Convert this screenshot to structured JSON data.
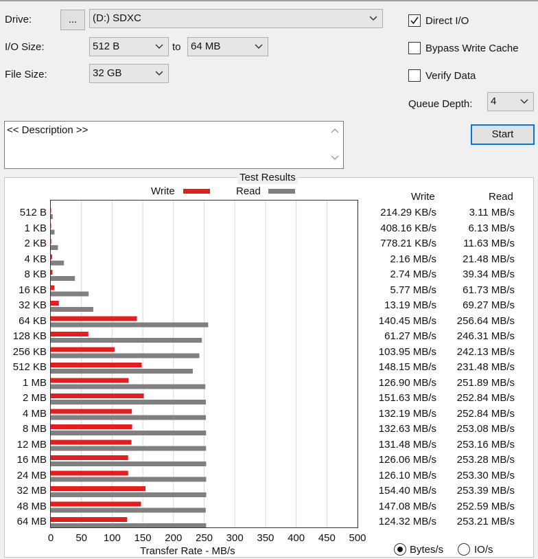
{
  "controls": {
    "drive_label": "Drive:",
    "browse_label": "...",
    "drive_value": "(D:) SDXC",
    "io_size_label": "I/O Size:",
    "io_from": "512 B",
    "io_to_label": "to",
    "io_to": "64 MB",
    "file_size_label": "File Size:",
    "file_size": "32 GB",
    "direct_io_label": "Direct I/O",
    "direct_io_checked": true,
    "bypass_cache_label": "Bypass Write Cache",
    "bypass_cache_checked": false,
    "verify_label": "Verify Data",
    "verify_checked": false,
    "queue_depth_label": "Queue Depth:",
    "queue_depth": "4",
    "start_label": "Start",
    "description": "<< Description >>"
  },
  "results": {
    "group_title": "Test Results",
    "legend_write": "Write",
    "legend_read": "Read",
    "col_write": "Write",
    "col_read": "Read",
    "x_axis_label": "Transfer Rate - MB/s",
    "unit_bytes_label": "Bytes/s",
    "unit_io_label": "IO/s",
    "unit_selected": "Bytes/s"
  },
  "colors": {
    "write": "#e02020",
    "read": "#808080",
    "focus": "#0078d7"
  },
  "chart_data": {
    "type": "bar",
    "orientation": "horizontal",
    "categories": [
      "512 B",
      "1 KB",
      "2 KB",
      "4 KB",
      "8 KB",
      "16 KB",
      "32 KB",
      "64 KB",
      "128 KB",
      "256 KB",
      "512 KB",
      "1 MB",
      "2 MB",
      "4 MB",
      "8 MB",
      "12 MB",
      "16 MB",
      "24 MB",
      "32 MB",
      "48 MB",
      "64 MB"
    ],
    "series": [
      {
        "name": "Write",
        "values": [
          0.21,
          0.4,
          0.76,
          2.16,
          2.74,
          5.77,
          13.19,
          140.45,
          61.27,
          103.95,
          148.15,
          126.9,
          151.63,
          132.19,
          132.63,
          131.48,
          126.06,
          126.1,
          154.4,
          147.08,
          124.32
        ]
      },
      {
        "name": "Read",
        "values": [
          3.11,
          6.13,
          11.63,
          21.48,
          39.34,
          61.73,
          69.27,
          256.64,
          246.31,
          242.13,
          231.48,
          251.89,
          252.84,
          252.84,
          253.08,
          253.16,
          253.28,
          253.3,
          253.39,
          252.59,
          253.21
        ]
      }
    ],
    "write_labels": [
      "214.29 KB/s",
      "408.16 KB/s",
      "778.21 KB/s",
      "2.16 MB/s",
      "2.74 MB/s",
      "5.77 MB/s",
      "13.19 MB/s",
      "140.45 MB/s",
      "61.27 MB/s",
      "103.95 MB/s",
      "148.15 MB/s",
      "126.90 MB/s",
      "151.63 MB/s",
      "132.19 MB/s",
      "132.63 MB/s",
      "131.48 MB/s",
      "126.06 MB/s",
      "126.10 MB/s",
      "154.40 MB/s",
      "147.08 MB/s",
      "124.32 MB/s"
    ],
    "read_labels": [
      "3.11 MB/s",
      "6.13 MB/s",
      "11.63 MB/s",
      "21.48 MB/s",
      "39.34 MB/s",
      "61.73 MB/s",
      "69.27 MB/s",
      "256.64 MB/s",
      "246.31 MB/s",
      "242.13 MB/s",
      "231.48 MB/s",
      "251.89 MB/s",
      "252.84 MB/s",
      "252.84 MB/s",
      "253.08 MB/s",
      "253.16 MB/s",
      "253.28 MB/s",
      "253.30 MB/s",
      "253.39 MB/s",
      "252.59 MB/s",
      "253.21 MB/s"
    ],
    "x_ticks": [
      "0",
      "50",
      "100",
      "150",
      "200",
      "250",
      "300",
      "350",
      "400",
      "450",
      "500"
    ],
    "xlim": [
      0,
      500
    ],
    "xlabel": "Transfer Rate - MB/s",
    "grid": true,
    "legend": "top"
  }
}
